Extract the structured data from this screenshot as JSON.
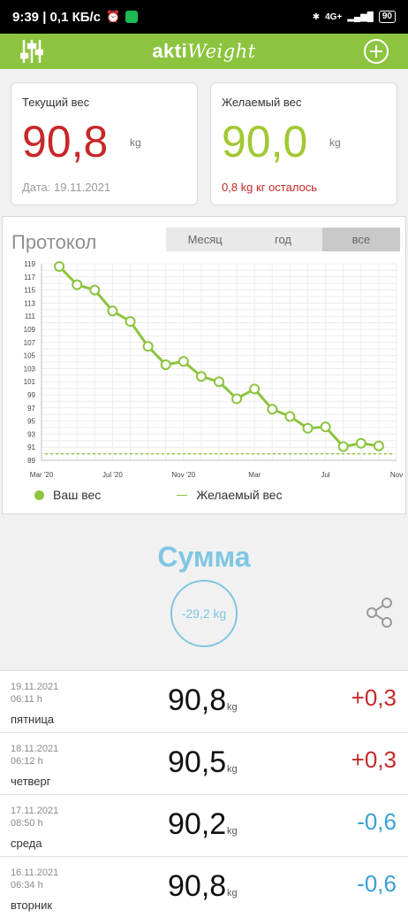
{
  "status": {
    "time_speed": "9:39 | 0,1 КБ/с",
    "network": "4G+",
    "battery": "90"
  },
  "app": {
    "brand_bold": "akti",
    "brand_light": "Weight"
  },
  "current": {
    "label": "Текущий вес",
    "value": "90,8",
    "unit": "kg",
    "date": "Дата: 19.11.2021"
  },
  "target": {
    "label": "Желаемый вес",
    "value": "90,0",
    "unit": "kg",
    "remaining": "0,8 kg кг осталось"
  },
  "protocol": {
    "title": "Протокол",
    "tabs": [
      "Месяц",
      "год",
      "все"
    ],
    "active_tab": 2
  },
  "chart_data": {
    "type": "line",
    "x_tick_labels": [
      "Mar '20",
      "Jul '20",
      "Nov '20",
      "Mar",
      "Jul",
      "Nov"
    ],
    "y_ticks": [
      89,
      91,
      93,
      95,
      97,
      99,
      101,
      103,
      105,
      107,
      109,
      111,
      113,
      115,
      117,
      119
    ],
    "ylim": [
      89,
      119
    ],
    "xlim": [
      0,
      20
    ],
    "series": [
      {
        "name": "Ваш вес",
        "color": "#8cc43f",
        "x": [
          1,
          2,
          3,
          4,
          5,
          6,
          7,
          8,
          9,
          10,
          11,
          12,
          13,
          14,
          15,
          16,
          17,
          18,
          19
        ],
        "values": [
          118.6,
          115.8,
          115.0,
          111.8,
          110.2,
          106.4,
          103.6,
          104.1,
          101.8,
          101.0,
          98.4,
          99.9,
          96.8,
          95.7,
          93.9,
          94.1,
          91.1,
          91.6,
          91.2
        ]
      },
      {
        "name": "Желаемый вес",
        "color": "#8cc43f",
        "values": [
          90.0
        ]
      }
    ],
    "legend": [
      "Ваш вес",
      "Желаемый вес"
    ]
  },
  "summary": {
    "title": "Сумма",
    "total": "-29,2 kg"
  },
  "entries": [
    {
      "date": "19.11.2021",
      "time": "06:11 h",
      "day": "пятница",
      "weight": "90,8",
      "unit": "kg",
      "delta": "+0,3",
      "delta_color": "#c62828"
    },
    {
      "date": "18.11.2021",
      "time": "06:12 h",
      "day": "четверг",
      "weight": "90,5",
      "unit": "kg",
      "delta": "+0,3",
      "delta_color": "#c62828"
    },
    {
      "date": "17.11.2021",
      "time": "08:50 h",
      "day": "среда",
      "weight": "90,2",
      "unit": "kg",
      "delta": "-0,6",
      "delta_color": "#3aa0d8"
    },
    {
      "date": "16.11.2021",
      "time": "06:34 h",
      "day": "вторник",
      "weight": "90,8",
      "unit": "kg",
      "delta": "-0,6",
      "delta_color": "#3aa0d8"
    }
  ]
}
